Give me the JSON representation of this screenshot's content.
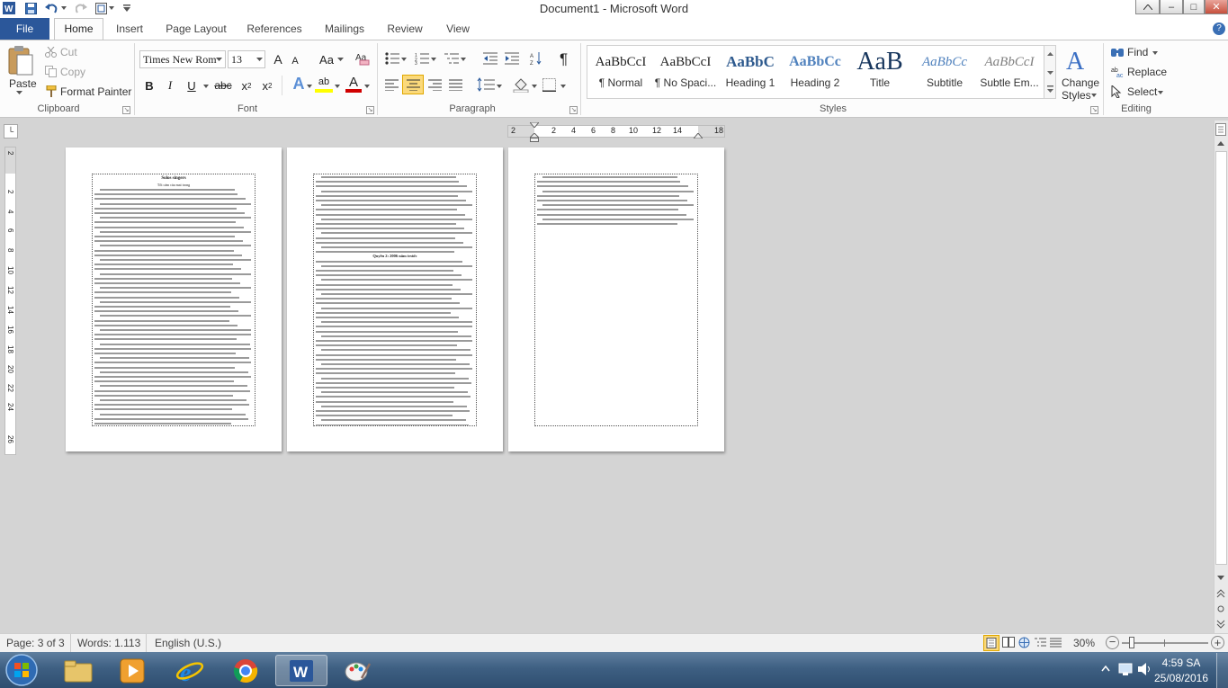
{
  "window": {
    "title": "Document1 - Microsoft Word",
    "controls": {
      "minimize": "–",
      "maximize": "□",
      "close": "✕"
    }
  },
  "ribbon_tabs": [
    "File",
    "Home",
    "Insert",
    "Page Layout",
    "References",
    "Mailings",
    "Review",
    "View"
  ],
  "clipboard": {
    "paste": "Paste",
    "cut": "Cut",
    "copy": "Copy",
    "format_painter": "Format Painter",
    "group_label": "Clipboard"
  },
  "font": {
    "font_name": "Times New Rom",
    "font_size": "13",
    "grow": "A",
    "shrink": "A",
    "change_case": "Aa",
    "bold": "B",
    "italic": "I",
    "underline": "U",
    "strikethrough": "abc",
    "subscript": "x",
    "superscript": "x",
    "subscript_mark": "2",
    "superscript_mark": "2",
    "text_effects": "A",
    "highlight": "ab",
    "font_color": "A",
    "group_label": "Font"
  },
  "paragraph": {
    "show_marks": "¶",
    "group_label": "Paragraph"
  },
  "styles": {
    "items": [
      {
        "preview": "AaBbCcI",
        "name": "¶ Normal"
      },
      {
        "preview": "AaBbCcI",
        "name": "¶ No Spaci..."
      },
      {
        "preview": "AaBbC",
        "name": "Heading 1"
      },
      {
        "preview": "AaBbCc",
        "name": "Heading 2"
      },
      {
        "preview": "AaB",
        "name": "Title"
      },
      {
        "preview": "AaBbCc",
        "name": "Subtitle"
      },
      {
        "preview": "AaBbCcI",
        "name": "Subtle Em..."
      }
    ],
    "change_styles": [
      "Change",
      "Styles"
    ],
    "group_label": "Styles"
  },
  "editing": {
    "find": "Find",
    "replace": "Replace",
    "select": "Select",
    "group_label": "Editing"
  },
  "ruler": {
    "h_ticks": [
      "2",
      "2",
      "4",
      "6",
      "8",
      "10",
      "12",
      "14",
      "18"
    ],
    "v_ticks": [
      "2",
      "2",
      "4",
      "6",
      "8",
      "10",
      "12",
      "14",
      "16",
      "18",
      "20",
      "22",
      "24",
      "26"
    ]
  },
  "pages": [
    {
      "title": "Solos singers",
      "subtitle": "Tối cảm của mai trong"
    },
    {
      "title": "Quyền 2: 2006 năm trước",
      "subtitle": ""
    },
    {
      "title": "",
      "subtitle": ""
    }
  ],
  "status": {
    "page": "Page: 3 of 3",
    "words": "Words: 1.113",
    "language": "English (U.S.)",
    "zoom": "30%",
    "zoom_out": "−",
    "zoom_in": "+"
  },
  "taskbar": {
    "time": "4:59 SA",
    "date": "25/08/2016"
  },
  "colors": {
    "file_tab": "#2b579a",
    "highlight": "#ffff00",
    "font_color": "#d00000",
    "active_button": "#fbd97a",
    "word_icon": "#2b579a"
  }
}
